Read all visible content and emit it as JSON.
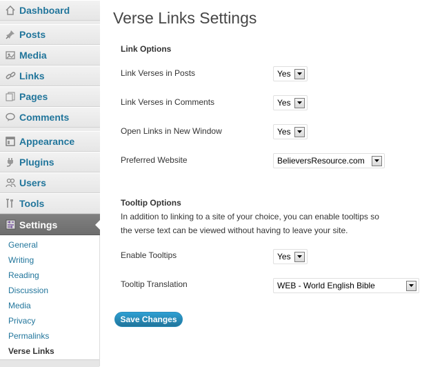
{
  "sidebar": {
    "items": [
      {
        "label": "Dashboard",
        "icon": "dashboard-icon"
      },
      {
        "label": "Posts",
        "icon": "pushpin-icon"
      },
      {
        "label": "Media",
        "icon": "media-icon"
      },
      {
        "label": "Links",
        "icon": "chain-link-icon"
      },
      {
        "label": "Pages",
        "icon": "pages-icon"
      },
      {
        "label": "Comments",
        "icon": "speech-bubble-icon"
      },
      {
        "label": "Appearance",
        "icon": "appearance-icon"
      },
      {
        "label": "Plugins",
        "icon": "plug-icon"
      },
      {
        "label": "Users",
        "icon": "users-icon"
      },
      {
        "label": "Tools",
        "icon": "tools-icon"
      },
      {
        "label": "Settings",
        "icon": "settings-icon"
      }
    ],
    "submenu": [
      "General",
      "Writing",
      "Reading",
      "Discussion",
      "Media",
      "Privacy",
      "Permalinks",
      "Verse Links"
    ],
    "current_submenu": "Verse Links"
  },
  "main": {
    "title": "Verse Links Settings",
    "link_options": {
      "heading": "Link Options",
      "rows": [
        {
          "label": "Link Verses in Posts",
          "value": "Yes"
        },
        {
          "label": "Link Verses in Comments",
          "value": "Yes"
        },
        {
          "label": "Open Links in New Window",
          "value": "Yes"
        },
        {
          "label": "Preferred Website",
          "value": "BelieversResource.com"
        }
      ]
    },
    "tooltip_options": {
      "heading": "Tooltip Options",
      "description_line1": "In addition to linking to a site of your choice, you can enable tooltips so",
      "description_line2": "the verse text can be viewed without having to leave your site.",
      "rows": [
        {
          "label": "Enable Tooltips",
          "value": "Yes"
        },
        {
          "label": "Tooltip Translation",
          "value": "WEB - World English Bible"
        }
      ]
    },
    "save_label": "Save Changes"
  },
  "colors": {
    "link": "#21759b",
    "current_menu": "#6d6d6d",
    "button": "#21759b"
  }
}
